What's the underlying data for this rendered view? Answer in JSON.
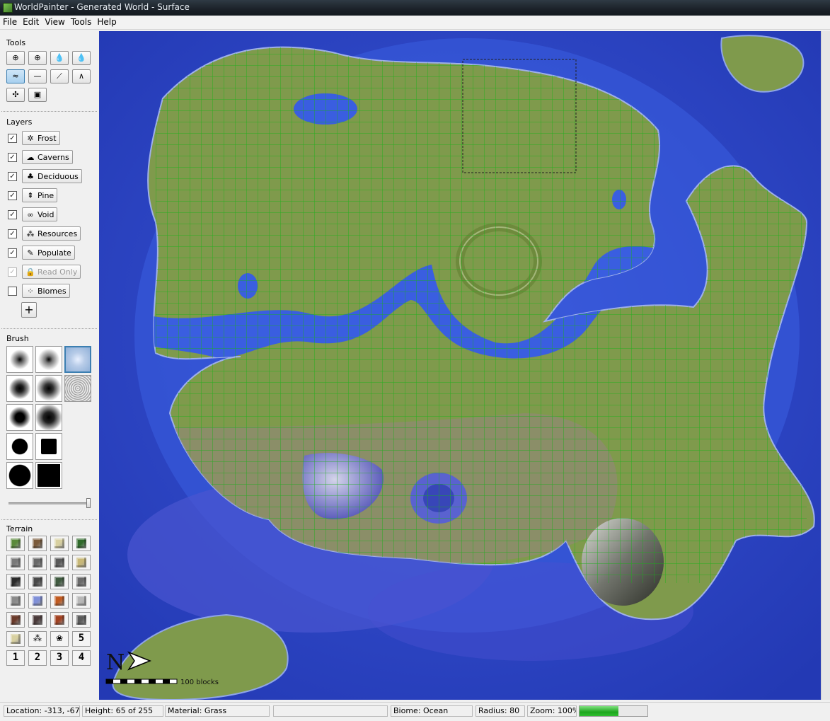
{
  "window": {
    "title": "WorldPainter - Generated World - Surface"
  },
  "menu": [
    "File",
    "Edit",
    "View",
    "Tools",
    "Help"
  ],
  "tools": {
    "label": "Tools",
    "buttons": [
      {
        "name": "raise-lower-tool",
        "icon": "raise-lower-icon"
      },
      {
        "name": "raise-mountain-tool",
        "icon": "mountain-icon"
      },
      {
        "name": "flood-water-tool",
        "icon": "water-drop-icon"
      },
      {
        "name": "flood-lava-tool",
        "icon": "lava-drop-icon"
      },
      {
        "name": "smooth-tool",
        "icon": "smooth-icon"
      },
      {
        "name": "flatten-tool",
        "icon": "flatten-icon"
      },
      {
        "name": "slope-tool",
        "icon": "slope-icon"
      },
      {
        "name": "ridge-tool",
        "icon": "ridge-icon"
      },
      {
        "name": "sponge-tool",
        "icon": "sponge-icon"
      },
      {
        "name": "text-tool",
        "icon": "text-icon"
      }
    ],
    "selected_index": 4
  },
  "layers": {
    "label": "Layers",
    "items": [
      {
        "label": "Frost",
        "checked": true,
        "icon": "frost-icon",
        "glyph": "✲"
      },
      {
        "label": "Caverns",
        "checked": true,
        "icon": "cavern-icon",
        "glyph": "☁"
      },
      {
        "label": "Deciduous",
        "checked": true,
        "icon": "tree-icon",
        "glyph": "♣"
      },
      {
        "label": "Pine",
        "checked": true,
        "icon": "pine-icon",
        "glyph": "⇞"
      },
      {
        "label": "Void",
        "checked": true,
        "icon": "void-icon",
        "glyph": "∞"
      },
      {
        "label": "Resources",
        "checked": true,
        "icon": "resources-icon",
        "glyph": "⁂"
      },
      {
        "label": "Populate",
        "checked": true,
        "icon": "populate-icon",
        "glyph": "✎"
      },
      {
        "label": "Read Only",
        "checked": true,
        "disabled": true,
        "icon": "lock-icon",
        "glyph": "🔒"
      },
      {
        "label": "Biomes",
        "checked": false,
        "icon": "biomes-icon",
        "glyph": "⁘"
      }
    ],
    "add_label": "+"
  },
  "brush": {
    "label": "Brush",
    "selected_index": 2
  },
  "terrain": {
    "label": "Terrain",
    "custom_numbers": [
      "5",
      "1",
      "2",
      "3",
      "4"
    ]
  },
  "map": {
    "compass_label": "N",
    "scale_label": "100 blocks"
  },
  "status": {
    "location": "Location: -313, -67",
    "height": "Height: 65 of 255",
    "material": "Material: Grass",
    "empty": "",
    "biome": "Biome: Ocean",
    "radius": "Radius: 80",
    "zoom": "Zoom: 100%",
    "progress": 0.57
  },
  "colors": {
    "ocean": "#2f48c0",
    "grass": "#7f9a4c",
    "grid": "#19b019",
    "selection": "#202020"
  }
}
